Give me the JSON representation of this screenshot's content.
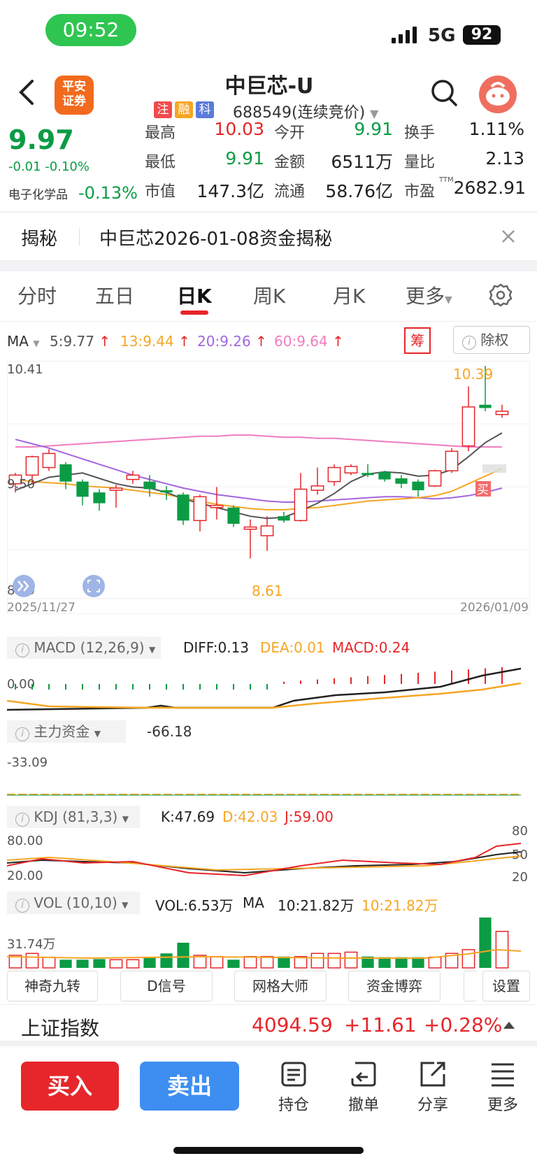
{
  "status": {
    "time": "09:52",
    "network": "5G",
    "battery": "92"
  },
  "header": {
    "logo_line1": "平安",
    "logo_line2": "证券",
    "stock_name": "中巨芯-U",
    "tags": [
      "注",
      "融",
      "科"
    ],
    "code": "688549(连续竞价)"
  },
  "quote": {
    "price": "9.97",
    "change": "-0.01  -0.10%",
    "sector": "电子化学品",
    "sector_change": "-0.13%",
    "fields": [
      {
        "label": "最高",
        "value": "10.03"
      },
      {
        "label": "今开",
        "value": "9.91"
      },
      {
        "label": "换手",
        "value": "1.11%"
      },
      {
        "label": "最低",
        "value": "9.91"
      },
      {
        "label": "金额",
        "value": "6511万"
      },
      {
        "label": "量比",
        "value": "2.13"
      },
      {
        "label": "市值",
        "value": "147.3亿"
      },
      {
        "label": "流通",
        "value": "58.76亿"
      },
      {
        "label": "市盈",
        "value": "2682.91"
      }
    ],
    "ttm": "TTM"
  },
  "reveal": {
    "label": "揭秘",
    "text": "中巨芯2026-01-08资金揭秘"
  },
  "tabs": [
    "分时",
    "五日",
    "日K",
    "周K",
    "月K",
    "更多"
  ],
  "ma_bar": {
    "ma": "MA",
    "ma5": "5:9.77",
    "ma13": "13:9.44",
    "ma20": "20:9.26",
    "ma60": "60:9.64",
    "chou": "筹",
    "fuquan": "除权"
  },
  "kline": {
    "y_top": "10.41",
    "y_mid": "9.50",
    "y_bottom": "8.29",
    "high_label": "10.39",
    "low_label": "8.61",
    "date_start": "2025/11/27",
    "date_end": "2026/01/09",
    "buy_mark": "买",
    "colors": {
      "up": "#e6262a",
      "down": "#0c9b45",
      "ma5": "#555555",
      "ma13": "#f5a623",
      "ma20": "#a366e0",
      "ma60": "#f07cc0"
    }
  },
  "chart_data": {
    "type": "candlestick",
    "ylim": [
      8.29,
      10.41
    ],
    "x_range": [
      "2025/11/27",
      "2026/01/09"
    ],
    "candles": [
      {
        "o": 9.3,
        "h": 9.4,
        "l": 9.22,
        "c": 9.38
      },
      {
        "o": 9.38,
        "h": 9.56,
        "l": 9.3,
        "c": 9.55
      },
      {
        "o": 9.45,
        "h": 9.62,
        "l": 9.42,
        "c": 9.58
      },
      {
        "o": 9.48,
        "h": 9.5,
        "l": 9.25,
        "c": 9.32
      },
      {
        "o": 9.32,
        "h": 9.34,
        "l": 9.1,
        "c": 9.18
      },
      {
        "o": 9.22,
        "h": 9.25,
        "l": 9.05,
        "c": 9.12
      },
      {
        "o": 9.24,
        "h": 9.29,
        "l": 9.08,
        "c": 9.26
      },
      {
        "o": 9.34,
        "h": 9.42,
        "l": 9.3,
        "c": 9.38
      },
      {
        "o": 9.32,
        "h": 9.38,
        "l": 9.18,
        "c": 9.25
      },
      {
        "o": 9.24,
        "h": 9.28,
        "l": 9.15,
        "c": 9.22
      },
      {
        "o": 9.2,
        "h": 9.22,
        "l": 8.92,
        "c": 8.96
      },
      {
        "o": 8.96,
        "h": 9.2,
        "l": 8.86,
        "c": 9.18
      },
      {
        "o": 9.08,
        "h": 9.27,
        "l": 8.97,
        "c": 9.1
      },
      {
        "o": 9.08,
        "h": 9.1,
        "l": 8.9,
        "c": 8.93
      },
      {
        "o": 8.88,
        "h": 8.97,
        "l": 8.61,
        "c": 8.9
      },
      {
        "o": 8.82,
        "h": 9.0,
        "l": 8.68,
        "c": 8.91
      },
      {
        "o": 9.0,
        "h": 9.04,
        "l": 8.94,
        "c": 8.96
      },
      {
        "o": 8.96,
        "h": 9.4,
        "l": 8.95,
        "c": 9.25
      },
      {
        "o": 9.24,
        "h": 9.45,
        "l": 9.2,
        "c": 9.28
      },
      {
        "o": 9.32,
        "h": 9.48,
        "l": 9.28,
        "c": 9.45
      },
      {
        "o": 9.4,
        "h": 9.48,
        "l": 9.38,
        "c": 9.46
      },
      {
        "o": 9.4,
        "h": 9.48,
        "l": 9.36,
        "c": 9.38
      },
      {
        "o": 9.41,
        "h": 9.42,
        "l": 9.32,
        "c": 9.34
      },
      {
        "o": 9.35,
        "h": 9.38,
        "l": 9.26,
        "c": 9.3
      },
      {
        "o": 9.32,
        "h": 9.34,
        "l": 9.18,
        "c": 9.24
      },
      {
        "o": 9.28,
        "h": 9.43,
        "l": 9.27,
        "c": 9.42
      },
      {
        "o": 9.42,
        "h": 9.63,
        "l": 9.4,
        "c": 9.6
      },
      {
        "o": 9.65,
        "h": 10.2,
        "l": 9.6,
        "c": 10.01
      },
      {
        "o": 10.03,
        "h": 10.39,
        "l": 9.97,
        "c": 10.0
      },
      {
        "o": 9.94,
        "h": 10.03,
        "l": 9.91,
        "c": 9.97
      }
    ],
    "ma5": [
      9.24,
      9.3,
      9.36,
      9.38,
      9.4,
      9.35,
      9.3,
      9.27,
      9.26,
      9.22,
      9.16,
      9.12,
      9.08,
      9.04,
      9.0,
      8.98,
      8.99,
      9.05,
      9.12,
      9.21,
      9.32,
      9.39,
      9.41,
      9.4,
      9.37,
      9.38,
      9.43,
      9.55,
      9.68,
      9.77
    ],
    "ma13": [
      9.34,
      9.32,
      9.31,
      9.3,
      9.28,
      9.27,
      9.26,
      9.24,
      9.22,
      9.2,
      9.17,
      9.14,
      9.11,
      9.09,
      9.07,
      9.06,
      9.06,
      9.07,
      9.08,
      9.1,
      9.12,
      9.14,
      9.15,
      9.16,
      9.17,
      9.19,
      9.23,
      9.3,
      9.37,
      9.44
    ],
    "ma20": [
      9.71,
      9.67,
      9.63,
      9.58,
      9.53,
      9.48,
      9.43,
      9.38,
      9.34,
      9.3,
      9.26,
      9.23,
      9.2,
      9.18,
      9.16,
      9.14,
      9.13,
      9.13,
      9.14,
      9.15,
      9.16,
      9.17,
      9.18,
      9.18,
      9.17,
      9.16,
      9.17,
      9.19,
      9.22,
      9.26
    ],
    "ma60": [
      9.64,
      9.64,
      9.65,
      9.66,
      9.67,
      9.68,
      9.69,
      9.7,
      9.71,
      9.72,
      9.73,
      9.74,
      9.74,
      9.75,
      9.75,
      9.74,
      9.73,
      9.73,
      9.72,
      9.72,
      9.71,
      9.7,
      9.69,
      9.68,
      9.67,
      9.66,
      9.65,
      9.64,
      9.64,
      9.64
    ]
  },
  "macd": {
    "label": "MACD (12,26,9)",
    "diff": "DIFF:0.13",
    "dea": "DEA:0.01",
    "macd": "MACD:0.24",
    "zero": "0.00"
  },
  "main_funds": {
    "label": "主力资金",
    "value": "-66.18",
    "axis": "-33.09"
  },
  "kdj": {
    "label": "KDJ (81,3,3)",
    "k": "K:47.69",
    "d": "D:42.03",
    "j": "J:59.00",
    "y80": "80.00",
    "y20": "20.00",
    "r80": "80",
    "r50": "50",
    "r20": "20"
  },
  "vol": {
    "label": "VOL (10,10)",
    "vol": "VOL:6.53万",
    "ma": "MA",
    "ma_val": "10:21.82万",
    "ma_val2": "10:21.82万",
    "axis": "31.74万",
    "values": [
      20,
      23,
      17,
      13,
      13,
      14,
      13,
      13,
      17,
      23,
      40,
      20,
      18,
      13,
      18,
      18,
      18,
      18,
      23,
      23,
      25,
      18,
      17,
      17,
      17,
      17,
      23,
      29,
      80,
      58,
      10
    ]
  },
  "tools": [
    "神奇九转",
    "D信号",
    "网格大师",
    "资金博弈",
    "设置"
  ],
  "index_bar": {
    "name": "上证指数",
    "value": "4094.59",
    "change": "+11.61",
    "percent": "+0.28%"
  },
  "bottom": {
    "buy": "买入",
    "sell": "卖出",
    "actions": [
      "持仓",
      "撤单",
      "分享",
      "更多"
    ]
  }
}
